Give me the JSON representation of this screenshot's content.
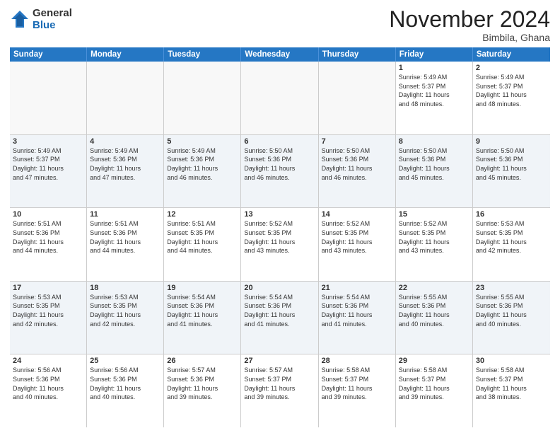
{
  "logo": {
    "general": "General",
    "blue": "Blue"
  },
  "header": {
    "month": "November 2024",
    "location": "Bimbila, Ghana"
  },
  "days": [
    "Sunday",
    "Monday",
    "Tuesday",
    "Wednesday",
    "Thursday",
    "Friday",
    "Saturday"
  ],
  "weeks": [
    [
      {
        "day": "",
        "info": ""
      },
      {
        "day": "",
        "info": ""
      },
      {
        "day": "",
        "info": ""
      },
      {
        "day": "",
        "info": ""
      },
      {
        "day": "",
        "info": ""
      },
      {
        "day": "1",
        "info": "Sunrise: 5:49 AM\nSunset: 5:37 PM\nDaylight: 11 hours\nand 48 minutes."
      },
      {
        "day": "2",
        "info": "Sunrise: 5:49 AM\nSunset: 5:37 PM\nDaylight: 11 hours\nand 48 minutes."
      }
    ],
    [
      {
        "day": "3",
        "info": "Sunrise: 5:49 AM\nSunset: 5:37 PM\nDaylight: 11 hours\nand 47 minutes."
      },
      {
        "day": "4",
        "info": "Sunrise: 5:49 AM\nSunset: 5:36 PM\nDaylight: 11 hours\nand 47 minutes."
      },
      {
        "day": "5",
        "info": "Sunrise: 5:49 AM\nSunset: 5:36 PM\nDaylight: 11 hours\nand 46 minutes."
      },
      {
        "day": "6",
        "info": "Sunrise: 5:50 AM\nSunset: 5:36 PM\nDaylight: 11 hours\nand 46 minutes."
      },
      {
        "day": "7",
        "info": "Sunrise: 5:50 AM\nSunset: 5:36 PM\nDaylight: 11 hours\nand 46 minutes."
      },
      {
        "day": "8",
        "info": "Sunrise: 5:50 AM\nSunset: 5:36 PM\nDaylight: 11 hours\nand 45 minutes."
      },
      {
        "day": "9",
        "info": "Sunrise: 5:50 AM\nSunset: 5:36 PM\nDaylight: 11 hours\nand 45 minutes."
      }
    ],
    [
      {
        "day": "10",
        "info": "Sunrise: 5:51 AM\nSunset: 5:36 PM\nDaylight: 11 hours\nand 44 minutes."
      },
      {
        "day": "11",
        "info": "Sunrise: 5:51 AM\nSunset: 5:36 PM\nDaylight: 11 hours\nand 44 minutes."
      },
      {
        "day": "12",
        "info": "Sunrise: 5:51 AM\nSunset: 5:35 PM\nDaylight: 11 hours\nand 44 minutes."
      },
      {
        "day": "13",
        "info": "Sunrise: 5:52 AM\nSunset: 5:35 PM\nDaylight: 11 hours\nand 43 minutes."
      },
      {
        "day": "14",
        "info": "Sunrise: 5:52 AM\nSunset: 5:35 PM\nDaylight: 11 hours\nand 43 minutes."
      },
      {
        "day": "15",
        "info": "Sunrise: 5:52 AM\nSunset: 5:35 PM\nDaylight: 11 hours\nand 43 minutes."
      },
      {
        "day": "16",
        "info": "Sunrise: 5:53 AM\nSunset: 5:35 PM\nDaylight: 11 hours\nand 42 minutes."
      }
    ],
    [
      {
        "day": "17",
        "info": "Sunrise: 5:53 AM\nSunset: 5:35 PM\nDaylight: 11 hours\nand 42 minutes."
      },
      {
        "day": "18",
        "info": "Sunrise: 5:53 AM\nSunset: 5:35 PM\nDaylight: 11 hours\nand 42 minutes."
      },
      {
        "day": "19",
        "info": "Sunrise: 5:54 AM\nSunset: 5:36 PM\nDaylight: 11 hours\nand 41 minutes."
      },
      {
        "day": "20",
        "info": "Sunrise: 5:54 AM\nSunset: 5:36 PM\nDaylight: 11 hours\nand 41 minutes."
      },
      {
        "day": "21",
        "info": "Sunrise: 5:54 AM\nSunset: 5:36 PM\nDaylight: 11 hours\nand 41 minutes."
      },
      {
        "day": "22",
        "info": "Sunrise: 5:55 AM\nSunset: 5:36 PM\nDaylight: 11 hours\nand 40 minutes."
      },
      {
        "day": "23",
        "info": "Sunrise: 5:55 AM\nSunset: 5:36 PM\nDaylight: 11 hours\nand 40 minutes."
      }
    ],
    [
      {
        "day": "24",
        "info": "Sunrise: 5:56 AM\nSunset: 5:36 PM\nDaylight: 11 hours\nand 40 minutes."
      },
      {
        "day": "25",
        "info": "Sunrise: 5:56 AM\nSunset: 5:36 PM\nDaylight: 11 hours\nand 40 minutes."
      },
      {
        "day": "26",
        "info": "Sunrise: 5:57 AM\nSunset: 5:36 PM\nDaylight: 11 hours\nand 39 minutes."
      },
      {
        "day": "27",
        "info": "Sunrise: 5:57 AM\nSunset: 5:37 PM\nDaylight: 11 hours\nand 39 minutes."
      },
      {
        "day": "28",
        "info": "Sunrise: 5:58 AM\nSunset: 5:37 PM\nDaylight: 11 hours\nand 39 minutes."
      },
      {
        "day": "29",
        "info": "Sunrise: 5:58 AM\nSunset: 5:37 PM\nDaylight: 11 hours\nand 39 minutes."
      },
      {
        "day": "30",
        "info": "Sunrise: 5:58 AM\nSunset: 5:37 PM\nDaylight: 11 hours\nand 38 minutes."
      }
    ]
  ]
}
